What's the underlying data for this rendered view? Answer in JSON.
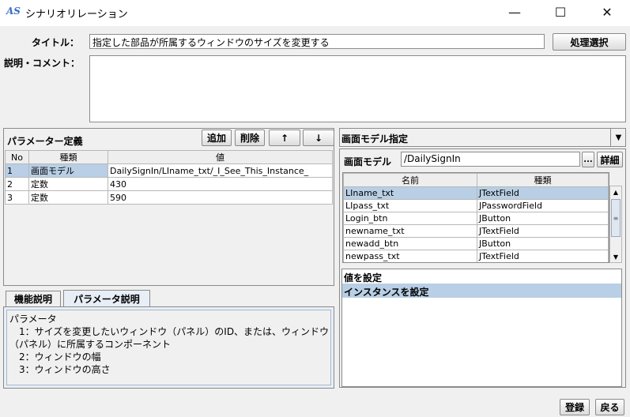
{
  "window": {
    "icon_text": "AS",
    "title": "シナリオリレーション",
    "minimize_glyph": "—",
    "maximize_glyph": "☐",
    "close_glyph": "✕"
  },
  "form": {
    "title_label": "タイトル：",
    "title_value": "指定した部品が所属するウィンドウのサイズを変更する",
    "select_button": "処理選択",
    "comment_label": "説明・コメント：",
    "comment_value": ""
  },
  "params": {
    "header": "パラメーター定義",
    "add_button": "追加",
    "delete_button": "削除",
    "up_button": "↑",
    "down_button": "↓",
    "columns": [
      "No",
      "種類",
      "値"
    ],
    "rows": [
      {
        "no": "1",
        "type": "画面モデル",
        "value": "DailySignIn/LIname_txt/_I_See_This_Instance_"
      },
      {
        "no": "2",
        "type": "定数",
        "value": "430"
      },
      {
        "no": "3",
        "type": "定数",
        "value": "590"
      }
    ]
  },
  "help_tabs": {
    "tab1": "機能説明",
    "tab2": "パラメータ説明",
    "lines": [
      "パラメータ",
      "　1：サイズを変更したいウィンドウ（パネル）のID、または、ウィンドウ",
      "（パネル）に所属するコンポーネント",
      "　2：ウィンドウの幅",
      "　3：ウィンドウの高さ"
    ]
  },
  "screen_model": {
    "combo_value": "画面モデル指定",
    "model_label": "画面モデル",
    "model_value": "/DailySignIn",
    "ellipsis_button": "...",
    "detail_button": "詳細",
    "columns": [
      "名前",
      "種類"
    ],
    "rows": [
      {
        "name": "LIname_txt",
        "type": "JTextField"
      },
      {
        "name": "LIpass_txt",
        "type": "JPasswordField"
      },
      {
        "name": "Login_btn",
        "type": "JButton"
      },
      {
        "name": "newname_txt",
        "type": "JTextField"
      },
      {
        "name": "newadd_btn",
        "type": "JButton"
      },
      {
        "name": "newpass_txt",
        "type": "JTextField"
      }
    ],
    "actions": [
      "値を設定",
      "インスタンスを設定"
    ]
  },
  "footer": {
    "register_button": "登録",
    "back_button": "戻る"
  }
}
